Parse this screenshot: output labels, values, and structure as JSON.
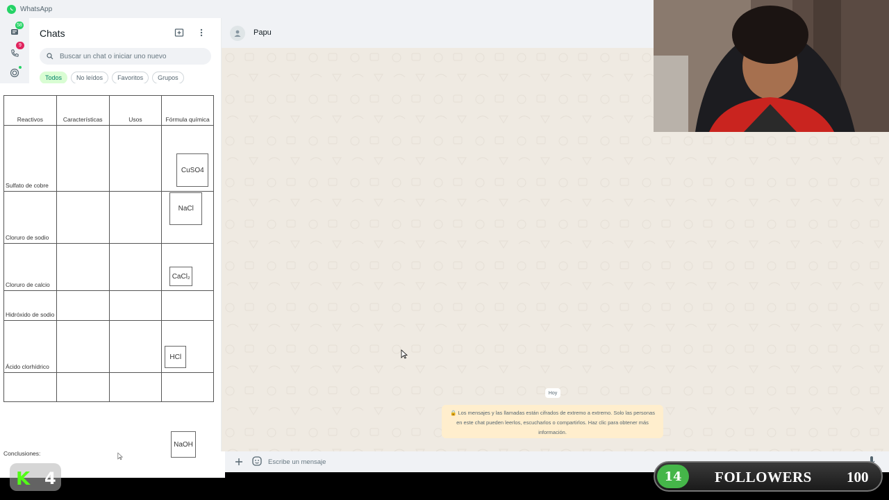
{
  "window": {
    "title": "WhatsApp"
  },
  "rail": {
    "chats_badge": "58",
    "calls_badge": "9"
  },
  "sidebar": {
    "title": "Chats",
    "search_placeholder": "Buscar un chat o iniciar uno nuevo",
    "filters": [
      "Todos",
      "No leídos",
      "Favoritos",
      "Grupos"
    ],
    "active_filter": "Todos"
  },
  "document": {
    "headers": [
      "Reactivos",
      "Características",
      "Usos",
      "Fórmula química"
    ],
    "rows": [
      {
        "reactivo": "Sulfato de cobre",
        "formula": "CuSO4"
      },
      {
        "reactivo": "Cloruro de sodio",
        "formula": "NaCl"
      },
      {
        "reactivo": "Cloruro de calcio",
        "formula": "CaCl₂"
      },
      {
        "reactivo": "Hidróxido de sodio",
        "formula": ""
      },
      {
        "reactivo": "Ácido clorhídrico",
        "formula": "HCl"
      },
      {
        "reactivo": "",
        "formula": ""
      }
    ],
    "conclusion_label": "Conclusiones:",
    "extra_formula": "NaOH"
  },
  "chat": {
    "contact_name": "Papu",
    "date_pill": "Hoy",
    "e2e_notice": "🔒 Los mensajes y las llamadas están cifrados de extremo a extremo. Solo las personas en este chat pueden leerlos, escucharlos o compartirlos. Haz clic para obtener más información.",
    "composer_placeholder": "Escribe un mensaje"
  },
  "overlay": {
    "kick_count": "4",
    "followers_count": "14",
    "followers_label": "FOLLOWERS",
    "followers_goal": "100"
  },
  "colors": {
    "whatsapp_green": "#25d366",
    "chat_background": "#efeae2",
    "notice_background": "#ffeecd",
    "kick_green": "#53fc18",
    "followers_green": "#45b649"
  }
}
